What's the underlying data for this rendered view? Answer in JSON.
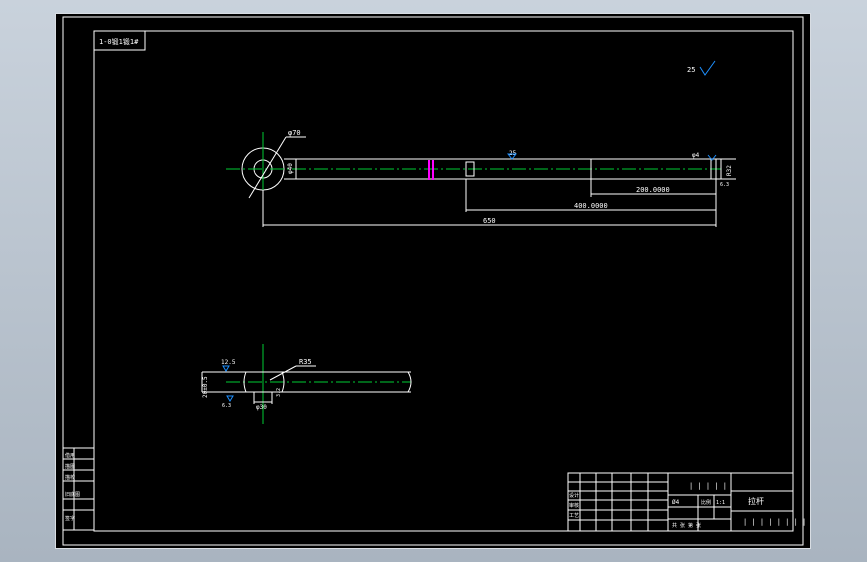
{
  "colors": {
    "background": "#000000",
    "line": "#ffffff",
    "centerline": "#00cc33",
    "symbol": "#1e90ff",
    "highlight": "#ff00ff",
    "frame": "#d8dde3"
  },
  "drawing": {
    "title_tab": "1-0锻1锻1#",
    "roughness_note": "25",
    "top_view": {
      "diameter_label": "φ70",
      "shaft_dim": "φ40",
      "roughness_mid": "25",
      "tip_label": "φ4",
      "tip_dim": "R32",
      "tip_tol": "6.3",
      "dim_200": "200.0000",
      "dim_400": "400.0000",
      "dim_650": "650"
    },
    "section_view": {
      "roughness_top": "12.5",
      "radius_label": "R35",
      "left_dim": "20±0.5",
      "bottom_left": "6.3",
      "bottom_mid": "φ30",
      "bottom_right": "3.2"
    },
    "title_block": {
      "part_name": "拉杆",
      "scale_label": "比例",
      "material": "| | | | |",
      "drawing_no": "| | | | | | | |",
      "rows": [
        "设计",
        "审核",
        "工艺"
      ],
      "code": "1:1",
      "weight": "Ø4",
      "sheet": "共 张 第 张",
      "lower": [
        "X",
        "X",
        "X"
      ]
    },
    "side_table": {
      "rows": [
        "借用",
        "描图",
        "描校",
        "旧底图",
        "签字"
      ]
    }
  }
}
